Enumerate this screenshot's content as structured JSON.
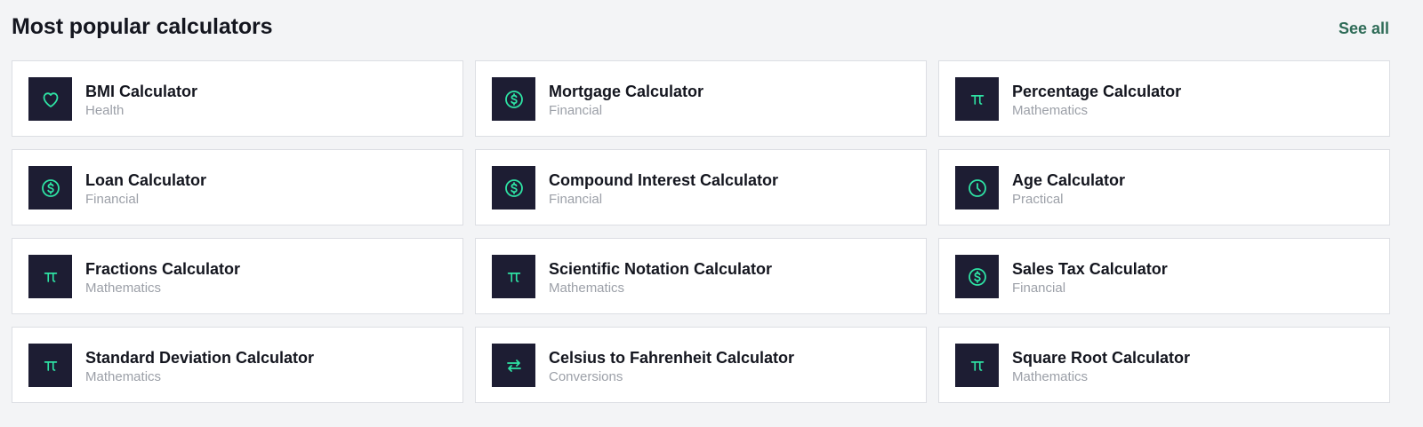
{
  "header": {
    "title": "Most popular calculators",
    "see_all_label": "See all"
  },
  "colors": {
    "background": "#f3f4f6",
    "card": "#ffffff",
    "icon_bg": "#1d1d33",
    "icon_accent": "#2ee3a4",
    "link": "#2e6b57"
  },
  "calculators": [
    {
      "name": "BMI Calculator",
      "category": "Health",
      "icon": "heart-icon"
    },
    {
      "name": "Mortgage Calculator",
      "category": "Financial",
      "icon": "dollar-icon"
    },
    {
      "name": "Percentage Calculator",
      "category": "Mathematics",
      "icon": "pi-icon"
    },
    {
      "name": "Loan Calculator",
      "category": "Financial",
      "icon": "dollar-icon"
    },
    {
      "name": "Compound Interest Calculator",
      "category": "Financial",
      "icon": "dollar-icon"
    },
    {
      "name": "Age Calculator",
      "category": "Practical",
      "icon": "clock-icon"
    },
    {
      "name": "Fractions Calculator",
      "category": "Mathematics",
      "icon": "pi-icon"
    },
    {
      "name": "Scientific Notation Calculator",
      "category": "Mathematics",
      "icon": "pi-icon"
    },
    {
      "name": "Sales Tax Calculator",
      "category": "Financial",
      "icon": "dollar-icon"
    },
    {
      "name": "Standard Deviation Calculator",
      "category": "Mathematics",
      "icon": "pi-icon"
    },
    {
      "name": "Celsius to Fahrenheit Calculator",
      "category": "Conversions",
      "icon": "swap-arrows-icon"
    },
    {
      "name": "Square Root Calculator",
      "category": "Mathematics",
      "icon": "pi-icon"
    }
  ]
}
